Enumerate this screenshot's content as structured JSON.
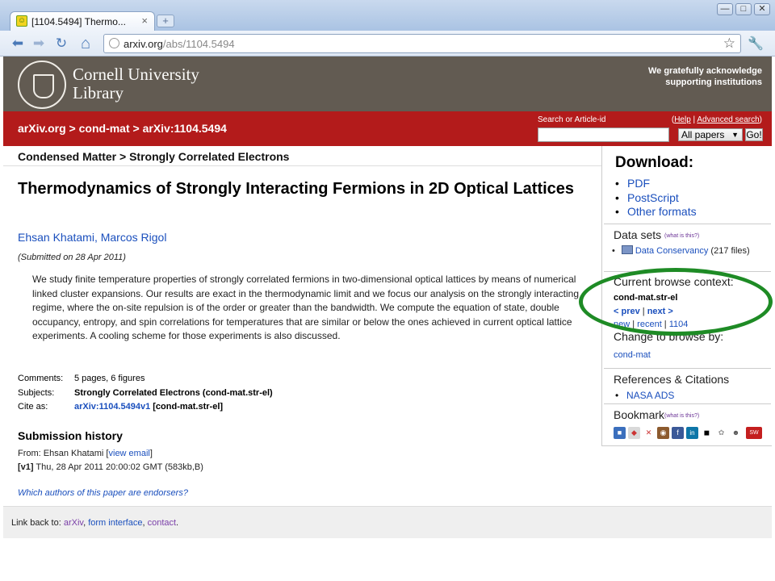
{
  "browser": {
    "tab_title": "[1104.5494] Thermo...",
    "tab_close": "×",
    "newtab": "+",
    "url_host": "arxiv.org",
    "url_path": "/abs/1104.5494",
    "minimize": "—",
    "maximize": "□",
    "close": "✕",
    "back": "⬅",
    "forward": "➡",
    "reload": "↻",
    "home": "⌂",
    "star": "☆",
    "wrench": "🔧"
  },
  "header": {
    "library_line1": "Cornell University",
    "library_line2": "Library",
    "ack_line1": "We gratefully acknowledge",
    "ack_line2": "supporting institutions"
  },
  "nav": {
    "crumb1": "arXiv.org",
    "sep1": " > ",
    "crumb2": "cond-mat",
    "sep2": " > ",
    "crumb3": "arXiv:1104.5494",
    "search_label": "Search or Article-id",
    "help_open": "(",
    "help": "Help",
    "help_sep": " | ",
    "advanced": "Advanced search",
    "help_close": ")",
    "select_value": "All papers",
    "select_caret": "▼",
    "go": "Go!"
  },
  "main": {
    "category": "Condensed Matter > Strongly Correlated Electrons",
    "title": "Thermodynamics of Strongly Interacting Fermions in 2D Optical Lattices",
    "author1": "Ehsan Khatami",
    "author_sep": ", ",
    "author2": "Marcos Rigol",
    "submitted": "(Submitted on 28 Apr 2011)",
    "abstract": "We study finite temperature properties of strongly correlated fermions in two-dimensional optical lattices by means of numerical linked cluster expansions. Our results are exact in the thermodynamic limit and we focus our analysis on the strongly interacting regime, where the on-site repulsion is of the order or greater than the bandwidth. We compute the equation of state, double occupancy, entropy, and spin correlations for temperatures that are similar or below the ones achieved in current optical lattice experiments. A cooling scheme for those experiments is also discussed.",
    "comments_label": "Comments:",
    "comments": "5 pages, 6 figures",
    "subjects_label": "Subjects:",
    "subjects": "Strongly Correlated Electrons (cond-mat.str-el)",
    "cite_label": "Cite as:",
    "cite_link": "arXiv:1104.5494v1",
    "cite_rest": " [cond-mat.str-el]",
    "history_heading": "Submission history",
    "from_prefix": "From: Ehsan Khatami [",
    "view_email": "view email",
    "from_suffix": "]",
    "v1_tag": "[v1]",
    "v1_rest": " Thu, 28 Apr 2011 20:00:02 GMT (583kb,B)",
    "endorsers": "Which authors of this paper are endorsers?"
  },
  "footer": {
    "prefix": "Link back to: ",
    "arxiv": "arXiv",
    "comma1": ", ",
    "form": "form interface",
    "comma2": ", ",
    "contact": "contact",
    "period": "."
  },
  "sidebar": {
    "download_heading": "Download:",
    "pdf": "PDF",
    "postscript": "PostScript",
    "other": "Other formats",
    "datasets_heading": "Data sets",
    "whatis1": "(what is this?)",
    "ds_bullet": "•",
    "ds_link": "Data Conservancy",
    "ds_count": " (217 files)",
    "browse_heading": "Current browse context:",
    "browse_context": "cond-mat.str-el",
    "prev": "< prev",
    "browse_sep": " | ",
    "next": "next >",
    "new": "new",
    "recent": "recent",
    "num": "1104",
    "change_heading": "Change to browse by:",
    "change_link": "cond-mat",
    "refs_heading": "References & Citations",
    "nasa": "NASA ADS",
    "bookmark_heading": "Bookmark",
    "whatis2": "(what is this?)",
    "bm_icons": [
      "■",
      "◆",
      "✕",
      "◉",
      "f",
      "in",
      "◼",
      "✿",
      "☻",
      "SW"
    ]
  }
}
